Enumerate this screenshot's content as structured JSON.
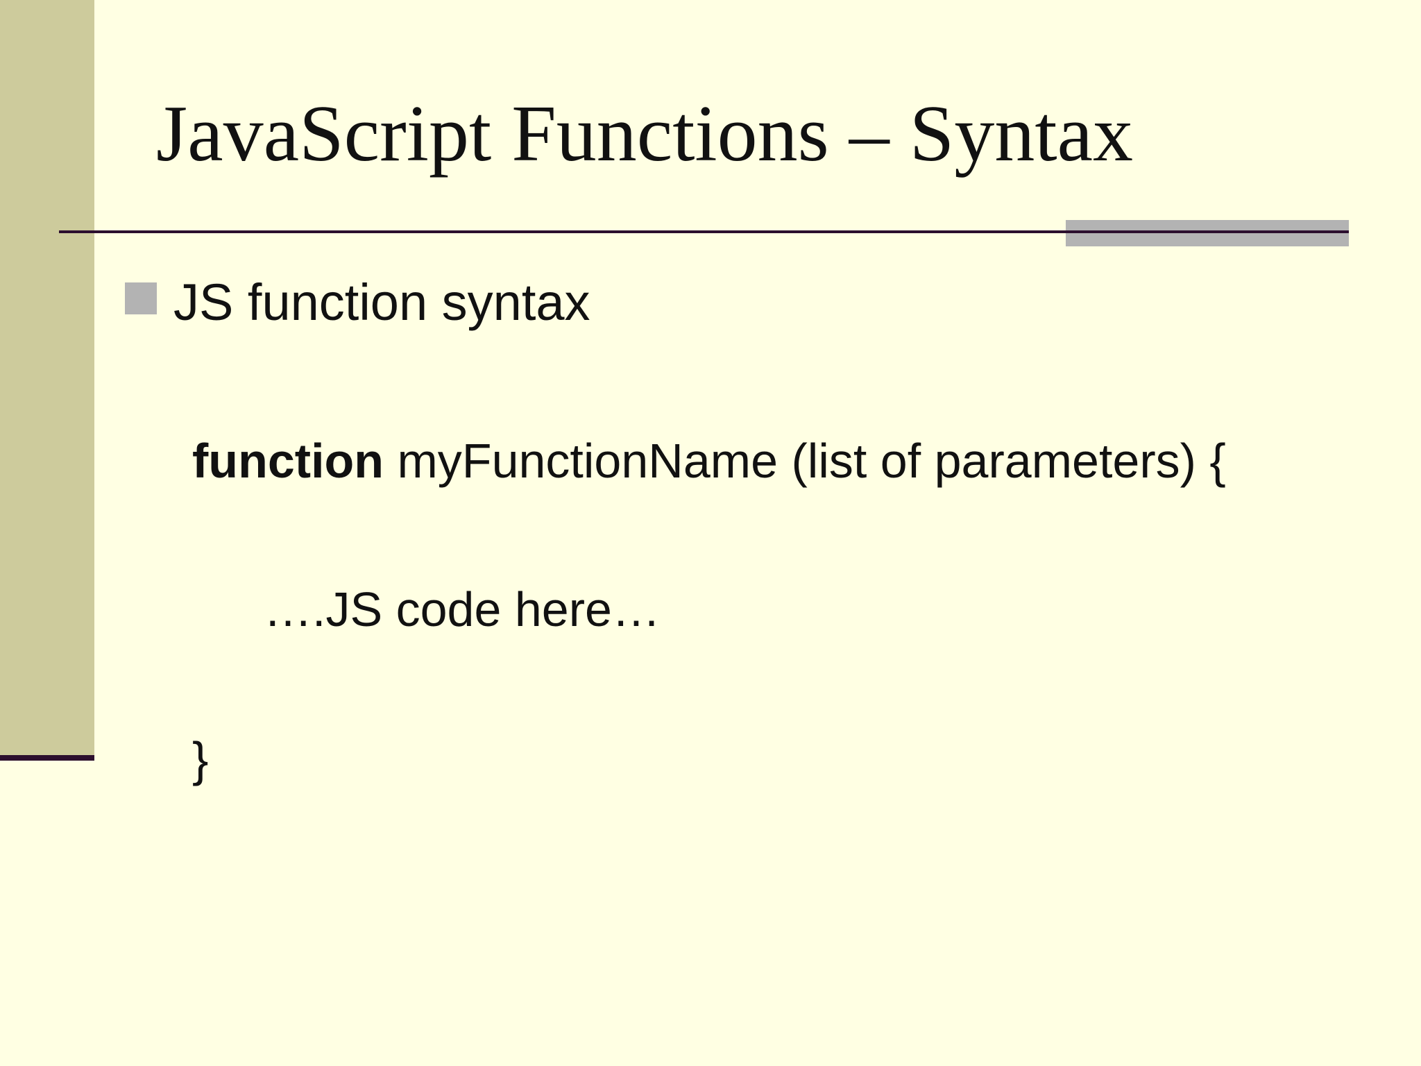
{
  "slide": {
    "title": "JavaScript Functions – Syntax",
    "bullet": "JS function syntax",
    "code": {
      "keyword": "function",
      "signature": " myFunctionName (list of parameters) {",
      "body": "….JS code here…",
      "closing": "}"
    }
  },
  "colors": {
    "background": "#ffffe3",
    "left_band": "#cdcb9c",
    "rule": "#2c0f2e",
    "accent": "#b3b3b3"
  }
}
